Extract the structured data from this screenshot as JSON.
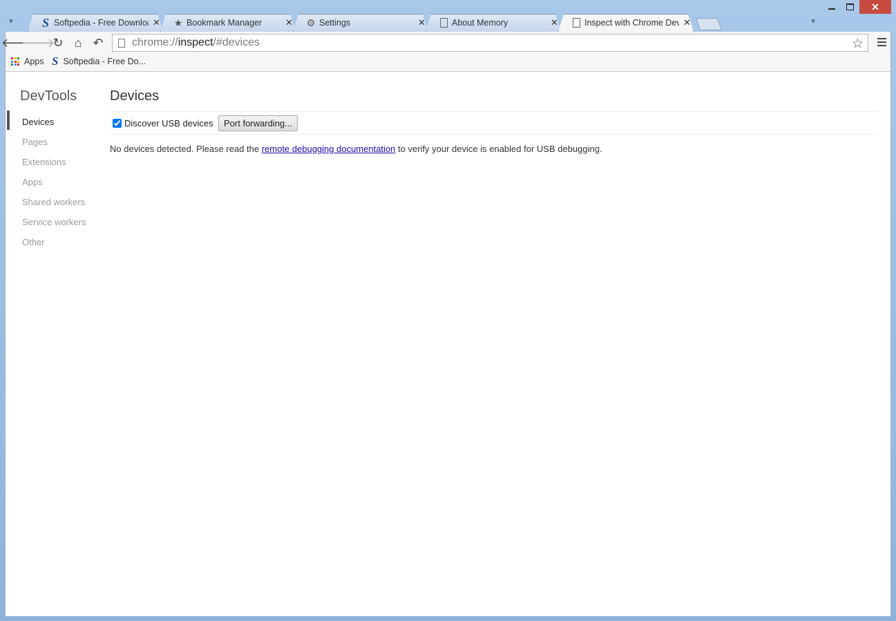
{
  "tabs": [
    {
      "label": "Softpedia - Free Downloads",
      "icon": "softpedia-s-icon",
      "active": false
    },
    {
      "label": "Bookmark Manager",
      "icon": "star-icon",
      "active": false
    },
    {
      "label": "Settings",
      "icon": "gear-icon",
      "active": false
    },
    {
      "label": "About Memory",
      "icon": "page-icon",
      "active": false
    },
    {
      "label": "Inspect with Chrome Developer Tools",
      "icon": "page-icon",
      "active": true
    }
  ],
  "omnibox": {
    "scheme": "chrome://",
    "host": "inspect",
    "path": "/#devices"
  },
  "bookmarks": {
    "apps_label": "Apps",
    "softpedia_label": "Softpedia - Free Do..."
  },
  "sidebar": {
    "title": "DevTools",
    "items": [
      {
        "label": "Devices",
        "selected": true
      },
      {
        "label": "Pages",
        "selected": false
      },
      {
        "label": "Extensions",
        "selected": false
      },
      {
        "label": "Apps",
        "selected": false
      },
      {
        "label": "Shared workers",
        "selected": false
      },
      {
        "label": "Service workers",
        "selected": false
      },
      {
        "label": "Other",
        "selected": false
      }
    ]
  },
  "main": {
    "title": "Devices",
    "discover_label": "Discover USB devices",
    "discover_checked": true,
    "port_forwarding_label": "Port forwarding...",
    "message_before": "No devices detected. Please read the ",
    "message_link": "remote debugging documentation",
    "message_after": " to verify your device is enabled for USB debugging."
  },
  "colors": {
    "frame": "#a9c8ea",
    "close_button": "#c74a3e",
    "link": "#1a0dab"
  }
}
